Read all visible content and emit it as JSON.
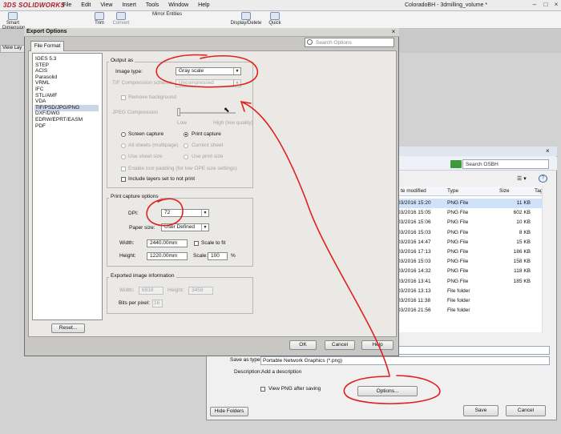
{
  "solidworks": {
    "logo": "3DS SOLIDWORKS",
    "menu": [
      "File",
      "Edit",
      "View",
      "Insert",
      "Tools",
      "Window",
      "Help"
    ],
    "document_title": "ColoradoBH - 3dmilling_volume *",
    "ribbon": {
      "smart_dimension": "Smart Dimension",
      "trim": "Trim",
      "convert": "Convert",
      "mirror_entities": "Mirror Entities",
      "display_delete": "Display/Delete",
      "quick": "Quick"
    },
    "view_tab": "View Lay"
  },
  "save_as": {
    "search_placeholder": "Search OSBH",
    "columns": {
      "date": "te modified",
      "type": "Type",
      "size": "Size",
      "tags": "Tags"
    },
    "rows": [
      {
        "date": "03/2016 15:20",
        "type": "PNG File",
        "size": "11 KB",
        "selected": true
      },
      {
        "date": "03/2016 15:05",
        "type": "PNG File",
        "size": "602 KB"
      },
      {
        "date": "03/2016 15:06",
        "type": "PNG File",
        "size": "10 KB"
      },
      {
        "date": "03/2016 15:03",
        "type": "PNG File",
        "size": "8 KB"
      },
      {
        "date": "03/2016 14:47",
        "type": "PNG File",
        "size": "15 KB"
      },
      {
        "date": "03/2016 17:13",
        "type": "PNG File",
        "size": "186 KB"
      },
      {
        "date": "03/2016 15:03",
        "type": "PNG File",
        "size": "158 KB"
      },
      {
        "date": "03/2016 14:32",
        "type": "PNG File",
        "size": "118 KB"
      },
      {
        "date": "03/2016 13:41",
        "type": "PNG File",
        "size": "185 KB"
      },
      {
        "date": "03/2016 13:13",
        "type": "File folder",
        "size": ""
      },
      {
        "date": "03/2016 11:38",
        "type": "File folder",
        "size": ""
      },
      {
        "date": "03/2016 21:56",
        "type": "File folder",
        "size": ""
      }
    ],
    "save_as_type_label": "Save as type:",
    "save_as_type_value": "Portable Network Graphics (*.png)",
    "description_label": "Description:",
    "description_value": "Add a description",
    "view_png_label": "View PNG after saving",
    "options_button": "Options...",
    "hide_folders": "Hide Folders",
    "save_button": "Save",
    "cancel_button": "Cancel"
  },
  "export_options": {
    "title": "Export Options",
    "search_placeholder": "Search Options",
    "tab": "File Format",
    "formats": [
      "IGES 5.3",
      "STEP",
      "ACIS",
      "Parasolid",
      "VRML",
      "IFC",
      "STL/AMF",
      "VDA",
      "TIF/PSD/JPG/PNG",
      "DXF/DWG",
      "EDRW/EPRT/EASM",
      "PDF"
    ],
    "selected_format": "TIF/PSD/JPG/PNG",
    "reset_button": "Reset...",
    "output_as": {
      "group_label": "Output as",
      "image_type_label": "Image type:",
      "image_type_value": "Gray scale",
      "tif_compression_label": "TIF Compression scheme:",
      "tif_compression_value": "Uncompressed",
      "remove_background_label": "Remove background",
      "jpeg_compression_label": "JPEG Compression",
      "slider_low": "Low",
      "slider_high": "High (low quality)",
      "screen_capture": "Screen capture",
      "print_capture": "Print capture",
      "all_sheets": "All sheets (multipage)",
      "current_sheet": "Current sheet",
      "use_sheet_size": "Use sheet size",
      "use_print_size": "Use print size",
      "enable_padding": "Enable tool padding (for low OPE size settings)",
      "include_layers": "Include layers set to not print"
    },
    "print_capture_options": {
      "group_label": "Print capture options",
      "dpi_label": "DPI:",
      "dpi_value": "72",
      "paper_size_label": "Paper size:",
      "paper_size_value": "User Defined",
      "width_label": "Width:",
      "width_value": "2440.00mm",
      "scale_to_fit_label": "Scale to fit",
      "height_label": "Height:",
      "height_value": "1220.00mm",
      "scale_label": "Scale:",
      "scale_value": "100",
      "scale_unit": "%"
    },
    "exported_image_info": {
      "group_label": "Exported image information",
      "width_label": "Width:",
      "width_value": "6918",
      "height_label": "Height:",
      "height_value": "3458",
      "bits_label": "Bits per pixel:",
      "bits_value": "16"
    },
    "ok_button": "OK",
    "cancel_button": "Cancel",
    "help_button": "Help"
  },
  "colors": {
    "annotation_red": "#e0201c",
    "list_selection": "#c9d6e8",
    "dialog_bg": "#ebe9e5"
  }
}
